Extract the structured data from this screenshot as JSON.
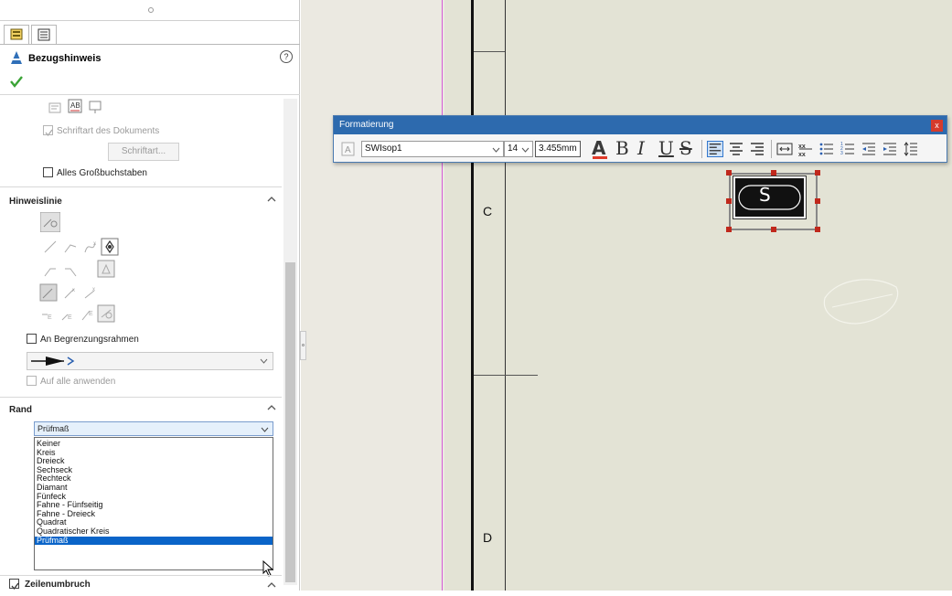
{
  "panel": {
    "header": {
      "title": "Bezugshinweis"
    },
    "text_section": {
      "doc_font_checkbox": "Schriftart des Dokuments",
      "font_button": "Schriftart...",
      "all_caps_checkbox": "Alles Großbuchstaben"
    },
    "leader_section": {
      "title": "Hinweislinie",
      "border_frame_checkbox": "An Begrenzungsrahmen",
      "apply_all_checkbox": "Auf alle anwenden"
    },
    "border_section": {
      "title": "Rand",
      "selected": "Prüfmaß",
      "options": [
        "Keiner",
        "Kreis",
        "Dreieck",
        "Sechseck",
        "Rechteck",
        "Diamant",
        "Fünfeck",
        "Fahne - Fünfseitig",
        "Fahne - Dreieck",
        "Quadrat",
        "Quadratischer Kreis",
        "Prüfmaß"
      ]
    },
    "footer": {
      "line_break_checkbox": "Zeilenumbruch"
    }
  },
  "formatting_toolbar": {
    "title": "Formatierung",
    "font": "SWIsop1",
    "size": "14",
    "height": "3.455mm",
    "glyphs": {
      "color": "A",
      "bold": "B",
      "italic": "I",
      "underline": "U",
      "strike": "S"
    }
  },
  "drawing": {
    "zone_c": "C",
    "zone_d": "D",
    "note_text": "S"
  },
  "colors": {
    "toolbar_title_bg": "#2d6aae",
    "list_selected": "#0a64c8",
    "checkmark": "#3aa335",
    "handle": "#c0281c"
  }
}
